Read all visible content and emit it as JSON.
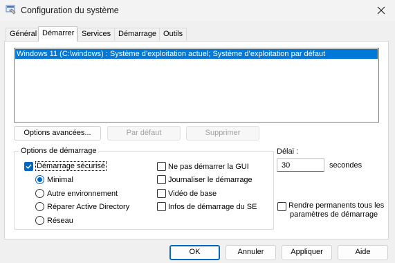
{
  "window": {
    "title": "Configuration du système"
  },
  "tabs": [
    {
      "label": "Général",
      "active": false
    },
    {
      "label": "Démarrer",
      "active": true
    },
    {
      "label": "Services",
      "active": false
    },
    {
      "label": "Démarrage",
      "active": false
    },
    {
      "label": "Outils",
      "active": false
    }
  ],
  "boot_list": {
    "items": [
      "Windows 11 (C:\\windows) : Système d’exploitation actuel; Système d’exploitation par défaut"
    ],
    "selected_index": 0
  },
  "list_buttons": {
    "advanced": "Options avancées...",
    "default": "Par défaut",
    "delete": "Supprimer"
  },
  "boot_options": {
    "label": "Options de démarrage",
    "safe_boot": {
      "label": "Démarrage sécurisé",
      "checked": true
    },
    "radios": [
      {
        "label": "Minimal",
        "selected": true
      },
      {
        "label": "Autre environnement",
        "selected": false
      },
      {
        "label": "Réparer Active Directory",
        "selected": false
      },
      {
        "label": "Réseau",
        "selected": false
      }
    ],
    "checks": [
      {
        "label": "Ne pas démarrer la GUI",
        "checked": false
      },
      {
        "label": "Journaliser le démarrage",
        "checked": false
      },
      {
        "label": "Vidéo de base",
        "checked": false
      },
      {
        "label": "Infos de démarrage du SE",
        "checked": false
      }
    ]
  },
  "timeout": {
    "label": "Délai :",
    "value": "30",
    "unit": "secondes"
  },
  "permanent": {
    "line1": "Rendre permanents tous les",
    "line2": "paramètres de démarrage",
    "checked": false
  },
  "footer": {
    "ok": "OK",
    "cancel": "Annuler",
    "apply": "Appliquer",
    "help": "Aide"
  },
  "colors": {
    "accent": "#0067c0",
    "selection": "#0078d7"
  }
}
